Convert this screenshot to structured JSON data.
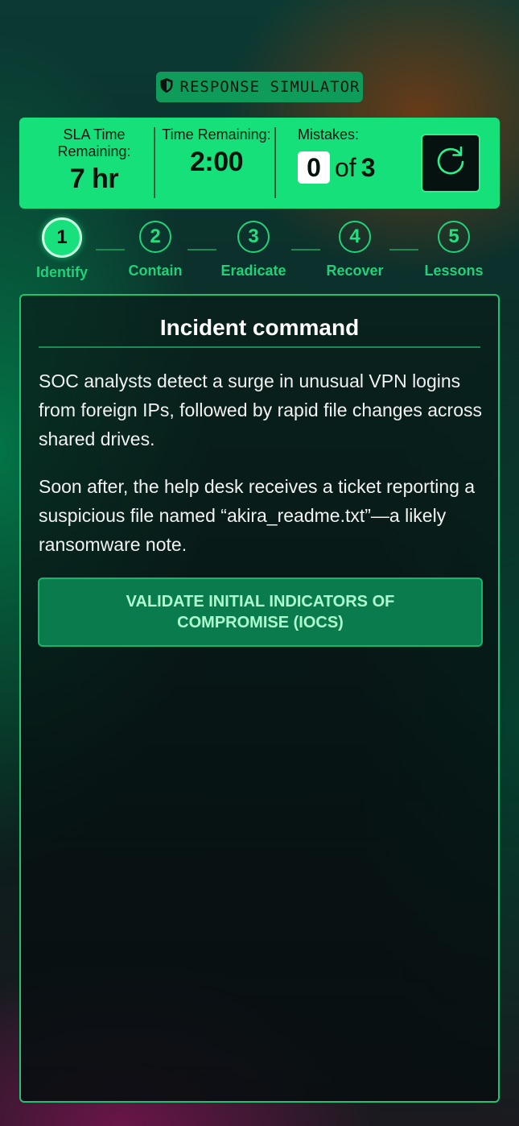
{
  "badge": {
    "icon": "shield-icon",
    "label": "RESPONSE SIMULATOR"
  },
  "stats": {
    "sla_label": "SLA Time Remaining:",
    "sla_value": "7 hr",
    "time_label": "Time Remaining:",
    "time_value": "2:00",
    "mistakes_label": "Mistakes:",
    "mistakes_count": "0",
    "mistakes_of": "of",
    "mistakes_max": "3",
    "reset_icon": "refresh-icon"
  },
  "steps": [
    {
      "number": "1",
      "label": "Identify",
      "active": true
    },
    {
      "number": "2",
      "label": "Contain",
      "active": false
    },
    {
      "number": "3",
      "label": "Eradicate",
      "active": false
    },
    {
      "number": "4",
      "label": "Recover",
      "active": false
    },
    {
      "number": "5",
      "label": "Lessons",
      "active": false
    }
  ],
  "panel": {
    "title": "Incident command",
    "paragraph_1": "SOC analysts detect a surge in unusual VPN logins from foreign IPs, followed by rapid file changes across shared drives.",
    "paragraph_2": "Soon after, the help desk receives a ticket reporting a suspicious file named “akira_readme.txt”—a likely ransomware note.",
    "action_label": "VALIDATE INITIAL INDICATORS OF COMPROMISE (IOCS)"
  },
  "colors": {
    "accent": "#15e07a",
    "panel_border": "#1fc472",
    "button_bg": "#0a7b4c",
    "button_text": "#aefad0"
  }
}
